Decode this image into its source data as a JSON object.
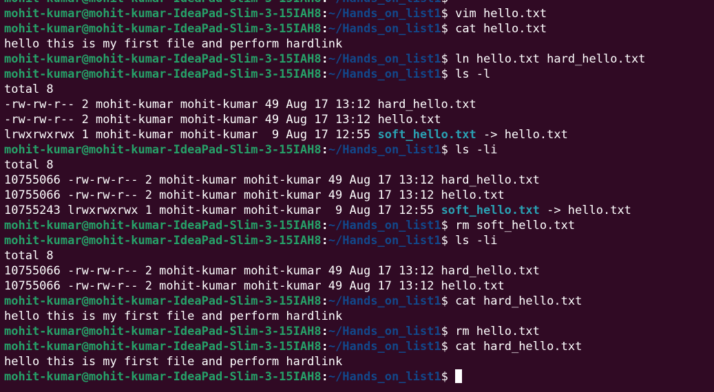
{
  "prompt": {
    "user_host": "mohit-kumar@mohit-kumar-IdeaPad-Slim-3-15IAH8",
    "separator": ":",
    "path": "~/Hands_on_list1",
    "symbol": "$"
  },
  "lines": [
    {
      "type": "prompt",
      "cmd": ""
    },
    {
      "type": "prompt",
      "cmd": "vim hello.txt"
    },
    {
      "type": "prompt",
      "cmd": "cat hello.txt"
    },
    {
      "type": "output",
      "text": "hello this is my first file and perform hardlink"
    },
    {
      "type": "prompt",
      "cmd": "ln hello.txt hard_hello.txt"
    },
    {
      "type": "prompt",
      "cmd": "ls -l"
    },
    {
      "type": "output",
      "text": "total 8"
    },
    {
      "type": "output",
      "text": "-rw-rw-r-- 2 mohit-kumar mohit-kumar 49 Aug 17 13:12 hard_hello.txt"
    },
    {
      "type": "output",
      "text": "-rw-rw-r-- 2 mohit-kumar mohit-kumar 49 Aug 17 13:12 hello.txt"
    },
    {
      "type": "symlink",
      "prefix": "lrwxrwxrwx 1 mohit-kumar mohit-kumar  9 Aug 17 12:55 ",
      "name": "soft_hello.txt",
      "target": " -> hello.txt"
    },
    {
      "type": "prompt",
      "cmd": "ls -li"
    },
    {
      "type": "output",
      "text": "total 8"
    },
    {
      "type": "output",
      "text": "10755066 -rw-rw-r-- 2 mohit-kumar mohit-kumar 49 Aug 17 13:12 hard_hello.txt"
    },
    {
      "type": "output",
      "text": "10755066 -rw-rw-r-- 2 mohit-kumar mohit-kumar 49 Aug 17 13:12 hello.txt"
    },
    {
      "type": "symlink",
      "prefix": "10755243 lrwxrwxrwx 1 mohit-kumar mohit-kumar  9 Aug 17 12:55 ",
      "name": "soft_hello.txt",
      "target": " -> hello.txt"
    },
    {
      "type": "prompt",
      "cmd": "rm soft_hello.txt"
    },
    {
      "type": "prompt",
      "cmd": "ls -li"
    },
    {
      "type": "output",
      "text": "total 8"
    },
    {
      "type": "output",
      "text": "10755066 -rw-rw-r-- 2 mohit-kumar mohit-kumar 49 Aug 17 13:12 hard_hello.txt"
    },
    {
      "type": "output",
      "text": "10755066 -rw-rw-r-- 2 mohit-kumar mohit-kumar 49 Aug 17 13:12 hello.txt"
    },
    {
      "type": "prompt",
      "cmd": "cat hard_hello.txt"
    },
    {
      "type": "output",
      "text": "hello this is my first file and perform hardlink"
    },
    {
      "type": "prompt",
      "cmd": "rm hello.txt"
    },
    {
      "type": "prompt",
      "cmd": "cat hard_hello.txt"
    },
    {
      "type": "output",
      "text": "hello this is my first file and perform hardlink"
    },
    {
      "type": "prompt",
      "cmd": "",
      "cursor": true
    }
  ],
  "colors": {
    "background": "#300a24",
    "user_host": "#26a269",
    "path": "#12488b",
    "text": "#ffffff",
    "symlink": "#2aa1b3"
  }
}
